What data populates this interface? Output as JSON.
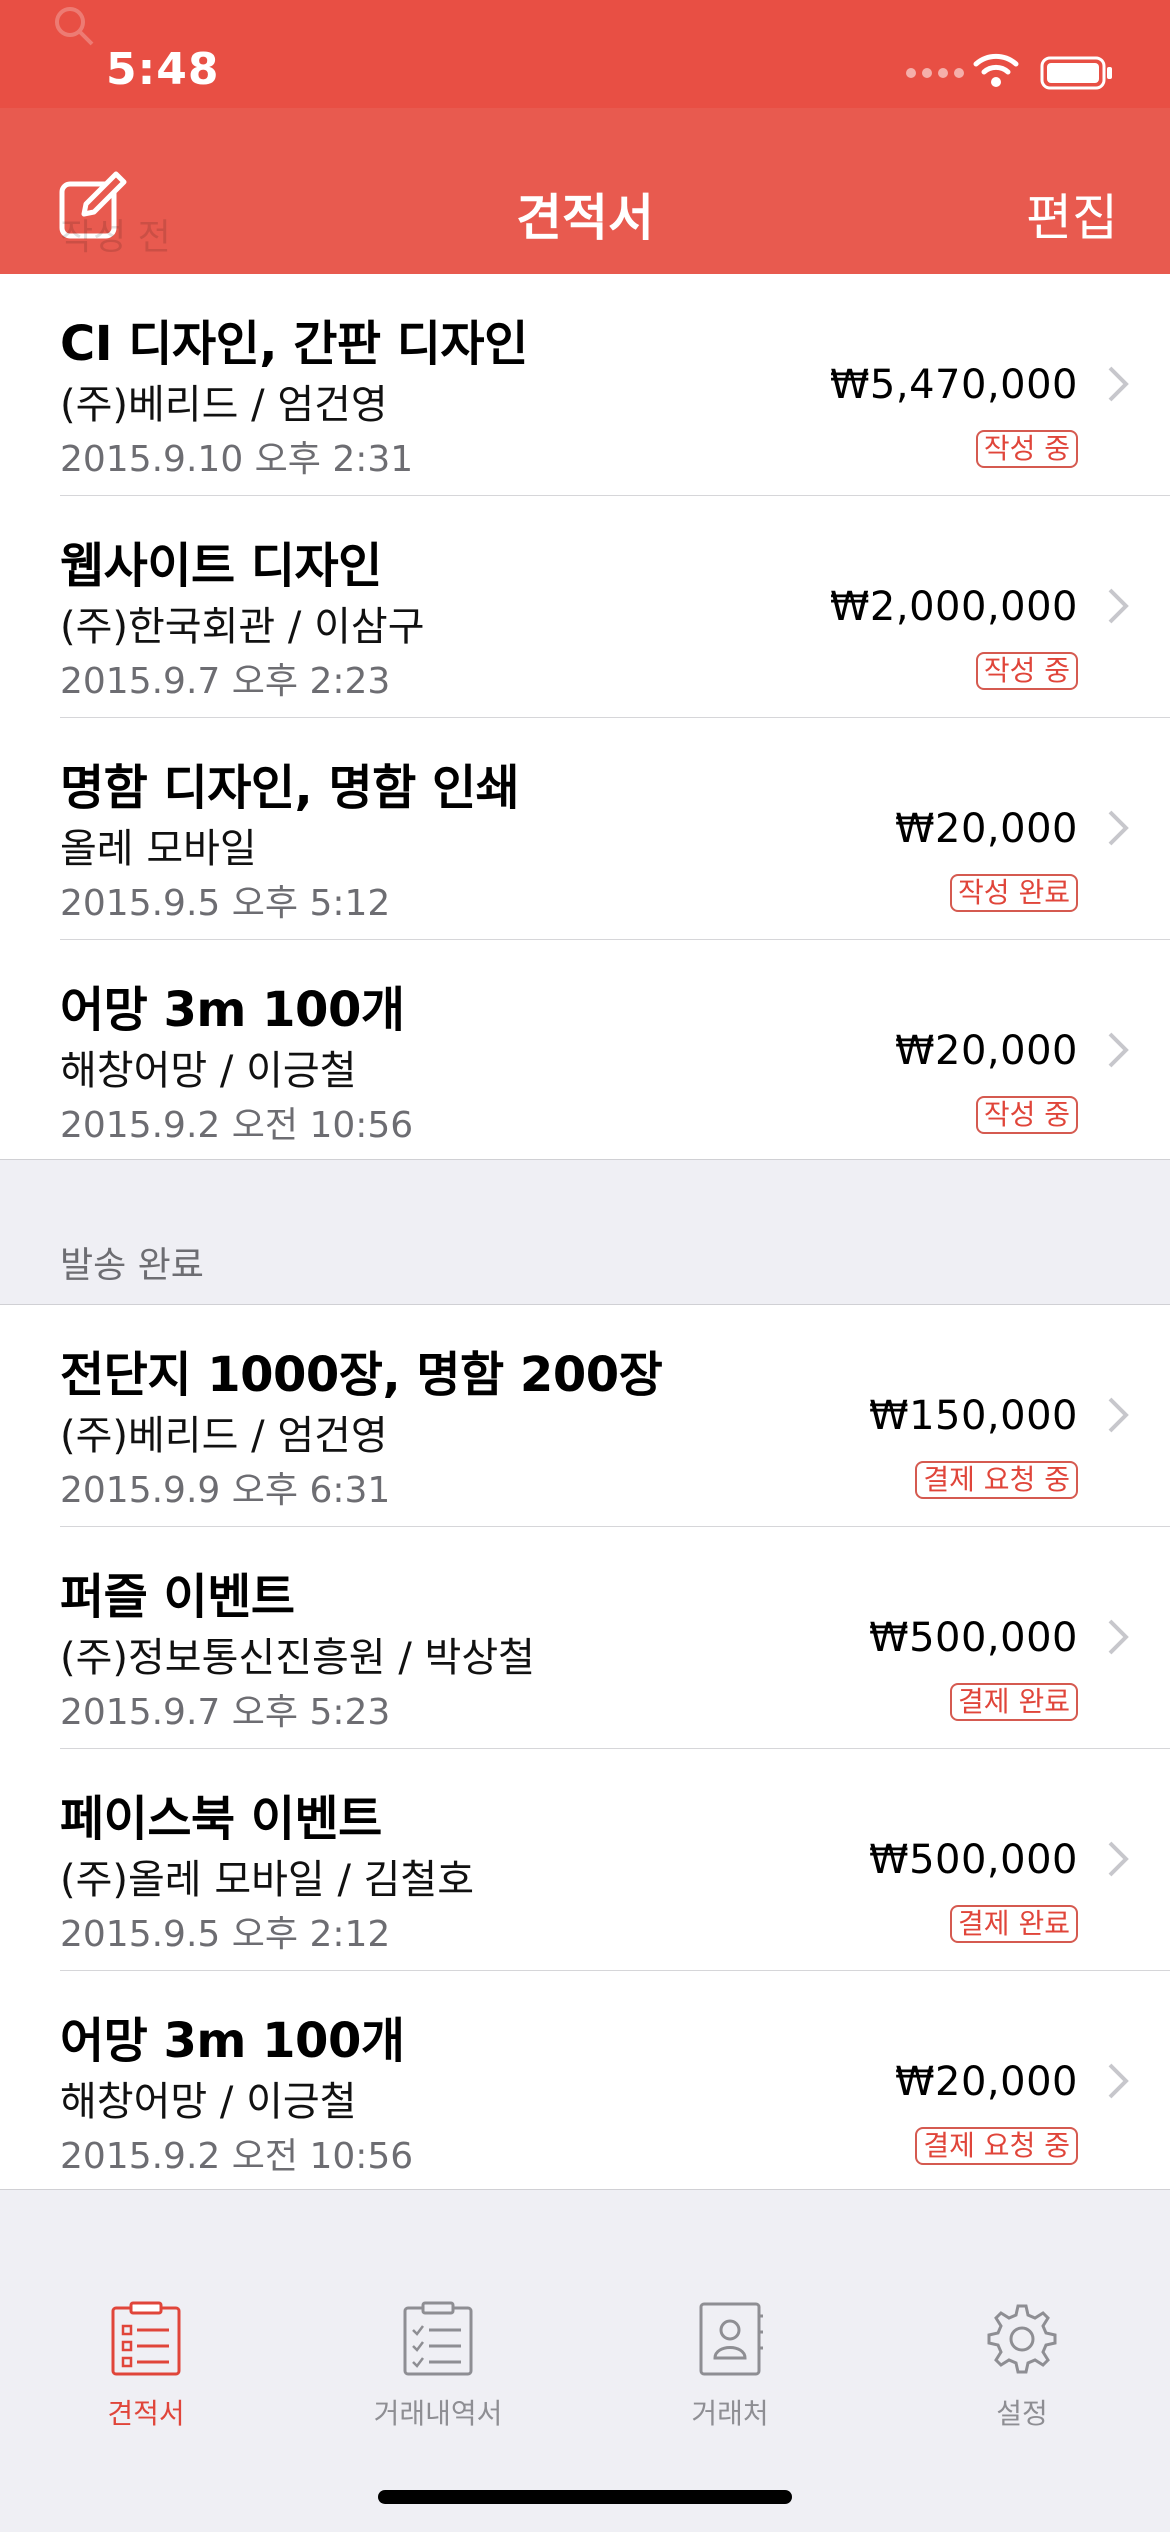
{
  "status_bar": {
    "time": "5:48"
  },
  "nav": {
    "title": "견적서",
    "edit_label": "편집",
    "ghost_header": "작성 전"
  },
  "section_sent": {
    "header": "발송 완료"
  },
  "draft_items": [
    {
      "title": "CI 디자인, 간판 디자인",
      "client": "(주)베리드 / 엄건영",
      "date": "2015.9.10 오후 2:31",
      "amount": "₩5,470,000",
      "status": "작성 중"
    },
    {
      "title": "웹사이트 디자인",
      "client": "(주)한국회관 / 이삼구",
      "date": "2015.9.7 오후 2:23",
      "amount": "₩2,000,000",
      "status": "작성 중"
    },
    {
      "title": "명함 디자인, 명함 인쇄",
      "client": "올레 모바일",
      "date": "2015.9.5 오후 5:12",
      "amount": "₩20,000",
      "status": "작성 완료"
    },
    {
      "title": "어망 3m 100개",
      "client": "해창어망 / 이긍철",
      "date": "2015.9.2 오전 10:56",
      "amount": "₩20,000",
      "status": "작성 중"
    }
  ],
  "sent_items": [
    {
      "title": "전단지 1000장, 명함 200장",
      "client": "(주)베리드 / 엄건영",
      "date": "2015.9.9 오후 6:31",
      "amount": "₩150,000",
      "status": "결제 요청 중"
    },
    {
      "title": "퍼즐 이벤트",
      "client": "(주)정보통신진흥원 / 박상철",
      "date": "2015.9.7 오후 5:23",
      "amount": "₩500,000",
      "status": "결제 완료"
    },
    {
      "title": "페이스북 이벤트",
      "client": "(주)올레 모바일 / 김철호",
      "date": "2015.9.5 오후 2:12",
      "amount": "₩500,000",
      "status": "결제 완료"
    },
    {
      "title": "어망 3m 100개",
      "client": "해창어망 / 이긍철",
      "date": "2015.9.2 오전 10:56",
      "amount": "₩20,000",
      "status": "결제 요청 중"
    }
  ],
  "tabs": [
    {
      "label": "견적서",
      "icon": "estimate-icon",
      "active": true
    },
    {
      "label": "거래내역서",
      "icon": "transaction-list-icon",
      "active": false
    },
    {
      "label": "거래처",
      "icon": "contacts-icon",
      "active": false
    },
    {
      "label": "설정",
      "icon": "gear-icon",
      "active": false
    }
  ],
  "colors": {
    "accent": "#e84f44",
    "nav": "#e85a4f",
    "badge": "#e0453a"
  }
}
